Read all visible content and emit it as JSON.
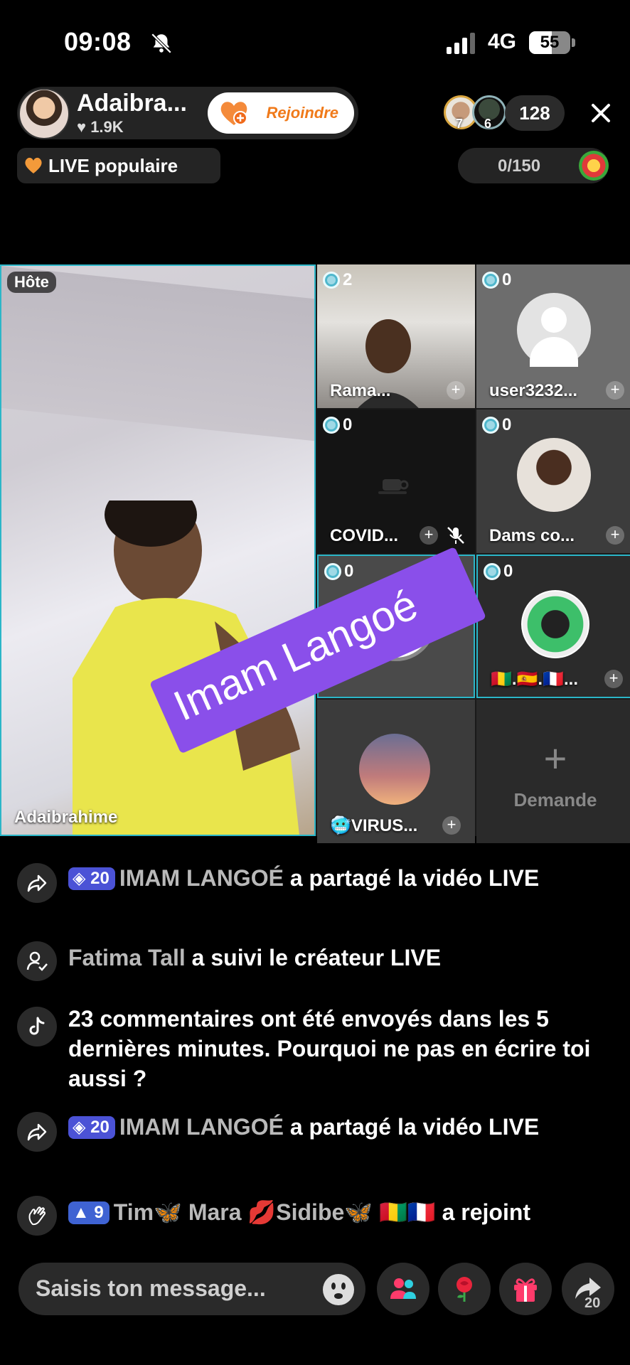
{
  "status_bar": {
    "time": "09:08",
    "network": "4G",
    "battery": "55"
  },
  "host": {
    "name": "Adaibra...",
    "likes": "1.9K",
    "follow_label": "Rejoindre"
  },
  "viewers": {
    "avatar_badges": [
      "7",
      "6"
    ],
    "count": "128"
  },
  "popular_label": "LIVE populaire",
  "goal": {
    "progress": "0/150"
  },
  "grid": {
    "host_badge": "Hôte",
    "host_name": "Adaibrahime",
    "guests": [
      {
        "name": "Rama...",
        "count": "2"
      },
      {
        "name": "user3232...",
        "count": "0"
      },
      {
        "name": "COVID...",
        "count": "0"
      },
      {
        "name": "Dams co...",
        "count": "0"
      },
      {
        "name": "",
        "count": "0"
      },
      {
        "name": "🇬🇳.🇪🇸.🇫🇷...",
        "count": "0"
      },
      {
        "name": "🥶VIRUS...",
        "count": ""
      }
    ],
    "request_label": "Demande"
  },
  "sticker_text": "Imam Langoé",
  "comments": [
    {
      "icon": "share-icon",
      "badge": "20",
      "user": "IMAM LANGOÉ",
      "text": "a partagé la vidéo LIVE"
    },
    {
      "icon": "follow-icon",
      "user": "Fatima Tall",
      "text": "a suivi le créateur LIVE"
    },
    {
      "icon": "tiktok-icon",
      "text": "23 commentaires ont été envoyés dans les 5 dernières minutes. Pourquoi ne pas en écrire toi aussi ?"
    },
    {
      "icon": "share-icon",
      "badge": "20",
      "user": "IMAM LANGOÉ",
      "text": "a partagé la vidéo LIVE"
    },
    {
      "icon": "wave-icon",
      "badge": "9",
      "user": "Tim🦋 Mara 💋Sidibe🦋 🇬🇳🇫🇷",
      "text": "a rejoint"
    }
  ],
  "composer": {
    "placeholder": "Saisis ton message...",
    "share_count": "20"
  }
}
